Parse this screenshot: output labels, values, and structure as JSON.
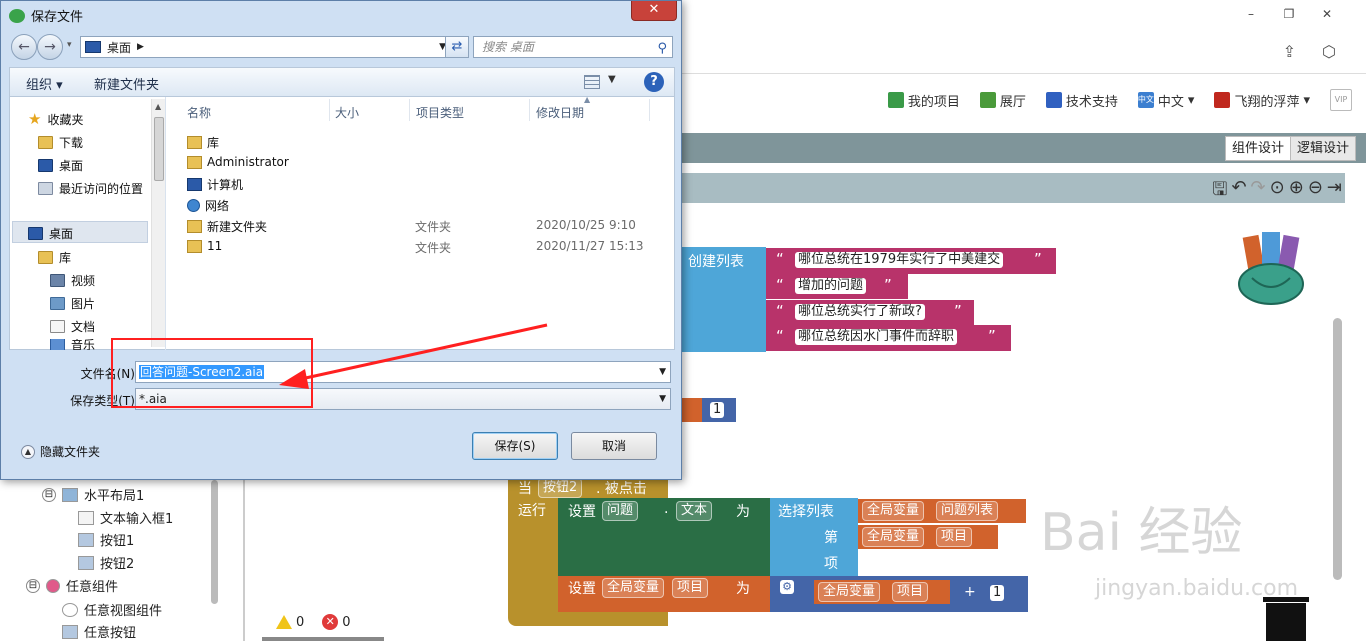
{
  "app": {
    "nav": {
      "my_projects": "我的项目",
      "gallery": "展厅",
      "support": "技术支持",
      "language": "中文",
      "language_icon_text": "中文",
      "user": "飞翔的浮萍",
      "vip": "VIP"
    },
    "mode_buttons": {
      "design": "组件设计",
      "blocks": "逻辑设计"
    },
    "window_controls": {
      "minimize": "–",
      "restore": "❐",
      "close": "✕"
    },
    "components_tree": [
      {
        "label": "水平布局1",
        "indent": 1,
        "toggle": "⊟"
      },
      {
        "label": "文本输入框1",
        "indent": 2,
        "toggle": ""
      },
      {
        "label": "按钮1",
        "indent": 2,
        "toggle": ""
      },
      {
        "label": "按钮2",
        "indent": 2,
        "toggle": ""
      },
      {
        "label": "任意组件",
        "indent": 0,
        "toggle": "⊟"
      },
      {
        "label": "任意视图组件",
        "indent": 1,
        "toggle": ""
      },
      {
        "label": "任意按钮",
        "indent": 1,
        "toggle": ""
      }
    ],
    "warnings": {
      "warn_count": "0",
      "error_count": "0"
    },
    "blocks": {
      "create_list": "创建列表",
      "strings": [
        "哪位总统在1979年实行了中美建交",
        "增加的问题",
        "哪位总统实行了新政?",
        "哪位总统因水门事件而辞职"
      ],
      "quote_open": "“",
      "quote_close": "”",
      "num_one": "1",
      "num_one_b": "1",
      "when": "当",
      "button2": "按钮2",
      "click": ". 被点击",
      "do": "运行",
      "set": "设置",
      "question_comp": "问题",
      "dot": ".",
      "text_prop": "文本",
      "to": "为",
      "select_list": "选择列表",
      "global_var": "全局变量",
      "question_list": "问题列表",
      "nth": "第",
      "item_word": "项",
      "index_var": "项目",
      "plus": "+"
    },
    "watermark": {
      "brand": "Bai 经验",
      "url": "jingyan.baidu.com"
    }
  },
  "dialog": {
    "title": "保存文件",
    "close_label": "✕",
    "address": "桌面",
    "search_placeholder": "搜索 桌面",
    "organize": "组织 ▾",
    "new_folder": "新建文件夹",
    "help": "?",
    "nav_items": [
      {
        "label": "收藏夹",
        "icon": "star-icon"
      },
      {
        "label": "下载",
        "icon": "download-folder-icon"
      },
      {
        "label": "桌面",
        "icon": "desktop-icon"
      },
      {
        "label": "最近访问的位置",
        "icon": "recent-places-icon"
      },
      {
        "label": "桌面",
        "icon": "desktop-icon"
      },
      {
        "label": "库",
        "icon": "library-icon"
      },
      {
        "label": "视频",
        "icon": "video-icon"
      },
      {
        "label": "图片",
        "icon": "picture-icon"
      },
      {
        "label": "文档",
        "icon": "document-icon"
      },
      {
        "label": "音乐",
        "icon": "music-icon"
      }
    ],
    "columns": {
      "name": "名称",
      "size": "大小",
      "type": "项目类型",
      "date": "修改日期"
    },
    "files": [
      {
        "name": "库",
        "type": "",
        "date": "",
        "icon": "library-icon"
      },
      {
        "name": "Administrator",
        "type": "",
        "date": "",
        "icon": "user-folder-icon"
      },
      {
        "name": "计算机",
        "type": "",
        "date": "",
        "icon": "computer-icon"
      },
      {
        "name": "网络",
        "type": "",
        "date": "",
        "icon": "network-icon"
      },
      {
        "name": "新建文件夹",
        "type": "文件夹",
        "date": "2020/10/25 9:10",
        "icon": "folder-icon"
      },
      {
        "name": "11",
        "type": "文件夹",
        "date": "2020/11/27 15:13",
        "icon": "folder-icon"
      }
    ],
    "filename_label": "文件名(N):",
    "filename_value": "回答问题-Screen2.aia",
    "filetype_label": "保存类型(T):",
    "filetype_value": "*.aia",
    "hide_folders": "隐藏文件夹",
    "save_button": "保存(S)",
    "cancel_button": "取消"
  },
  "colors": {
    "list_block": "#4ea6d8",
    "text_block": "#b8336a",
    "variable_block": "#d1622c",
    "setter_block": "#2a6e45",
    "event_block": "#b8912c",
    "math_block": "#4465a8",
    "annotation_red": "#ff2020",
    "selection_blue": "#3399ff"
  }
}
